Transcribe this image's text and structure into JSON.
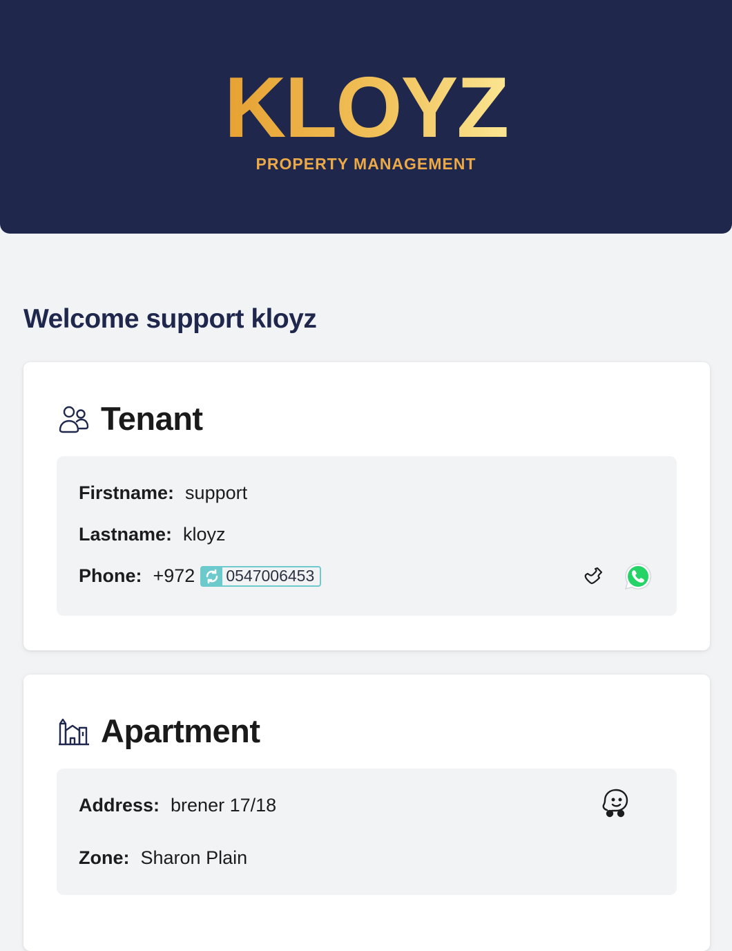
{
  "header": {
    "logo": "KLOYZ",
    "tagline": "PROPERTY MANAGEMENT"
  },
  "welcome": "Welcome support kloyz",
  "tenant": {
    "title": "Tenant",
    "icon": "users-icon",
    "firstname_label": "Firstname:",
    "firstname": "support",
    "lastname_label": "Lastname:",
    "lastname": "kloyz",
    "phone_label": "Phone:",
    "phone_prefix": "+972",
    "phone_number": "0547006453",
    "actions": [
      "phone-icon",
      "whatsapp-icon"
    ]
  },
  "apartment": {
    "title": "Apartment",
    "icon": "building-icon",
    "address_label": "Address:",
    "address": "brener 17/18",
    "zone_label": "Zone:",
    "zone": "Sharon Plain",
    "actions": [
      "waze-icon"
    ]
  },
  "colors": {
    "header_bg": "#1f284c",
    "logo_gradient_start": "#e6a132",
    "logo_gradient_end": "#fbe592",
    "tagline": "#eba948",
    "page_bg": "#f2f3f5",
    "whatsapp": "#25d366",
    "phone_badge": "#6cc9cc"
  }
}
